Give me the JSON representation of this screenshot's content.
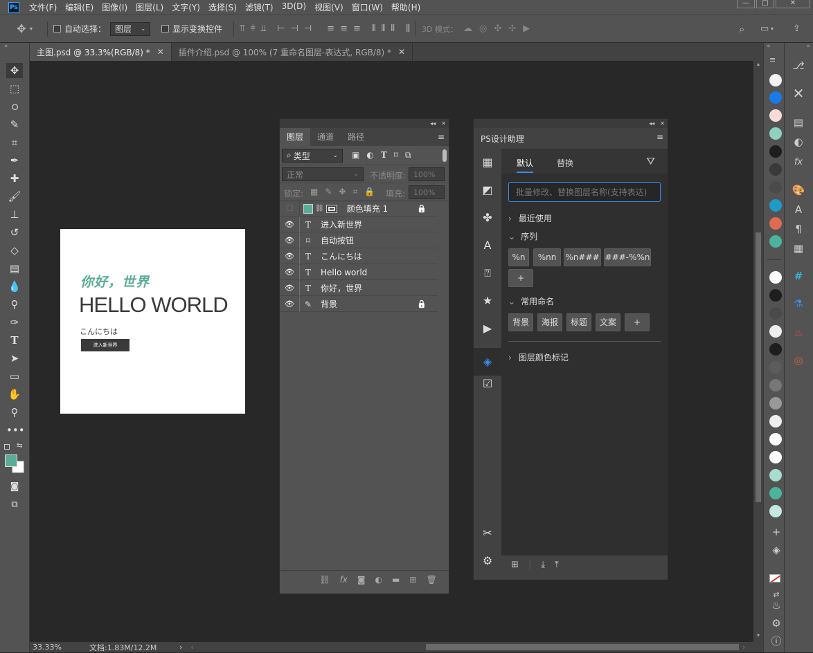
{
  "app": {
    "logo": "Ps"
  },
  "menu": [
    "文件(F)",
    "编辑(E)",
    "图像(I)",
    "图层(L)",
    "文字(Y)",
    "选择(S)",
    "滤镜(T)",
    "3D(D)",
    "视图(V)",
    "窗口(W)",
    "帮助(H)"
  ],
  "options": {
    "auto_select_label": "自动选择：",
    "auto_select_value": "图层",
    "show_transform_label": "显示变换控件",
    "mode_3d_label": "3D 模式："
  },
  "tabs": [
    {
      "label": "主图.psd @ 33.3%(RGB/8) *",
      "close": "✕",
      "active": true
    },
    {
      "label": "插件介绍.psd @ 100% (7 重命名图层-表达式, RGB/8) *",
      "close": "✕",
      "active": false
    }
  ],
  "document": {
    "chinese_title": "你好，世界",
    "headline": "HELLO WORLD",
    "japanese": "こんにちは",
    "button_text": "进入新世界",
    "accent": "#5aac98"
  },
  "status": {
    "zoom": "33.33%",
    "doc": "文档:1.83M/12.2M"
  },
  "layers_panel": {
    "tabs": [
      "图层",
      "通道",
      "路径"
    ],
    "filter": "类型",
    "blend_mode": "正常",
    "opacity_label": "不透明度:",
    "opacity_value": "100%",
    "lock_label": "锁定:",
    "fill_label": "填充:",
    "fill_value": "100%",
    "layers": [
      {
        "name": "颜色填充 1",
        "type": "fill",
        "visible": false,
        "locked": true
      },
      {
        "name": "进入新世界",
        "type": "text",
        "visible": true,
        "locked": false
      },
      {
        "name": "自动按钮",
        "type": "shape",
        "visible": true,
        "locked": false
      },
      {
        "name": "こんにちは",
        "type": "text",
        "visible": true,
        "locked": false
      },
      {
        "name": "Hello world",
        "type": "text",
        "visible": true,
        "locked": false
      },
      {
        "name": "你好，世界",
        "type": "text",
        "visible": true,
        "locked": false
      },
      {
        "name": "背景",
        "type": "brush",
        "visible": true,
        "locked": true
      }
    ]
  },
  "assistant_panel": {
    "title": "PS设计助理",
    "tabs": [
      "默认",
      "替换"
    ],
    "search_placeholder": "批量修改、替换图层名称(支持表达)",
    "sections": {
      "recent": "最近使用",
      "sequence": "序列",
      "common": "常用命名",
      "color_mark": "图层颜色标记"
    },
    "sequence_chips": [
      "%n",
      "%nn",
      "%n###",
      "###-%%n",
      "+"
    ],
    "name_chips": [
      "背景",
      "海报",
      "标题",
      "文案",
      "+"
    ]
  },
  "swatches": [
    "#f2f2f2",
    "#1a7ae8",
    "#f6dcd8",
    "#8fd0bf",
    "#1e1e1e",
    "#3a3a3a",
    "#4a4a4a",
    "#1f9ac9",
    "#e06b55",
    "#4db39a",
    "#ffffff",
    "#1e1e1e",
    "#4a4a4a",
    "#eeeeee",
    "#1e1e1e",
    "#5c5c5c",
    "#777777",
    "#999999",
    "#eeeeee",
    "#ffffff",
    "#ffffff",
    "#a8dccf",
    "#4db39a",
    "#c6e6e0",
    "#f2f2f2"
  ],
  "colors": {
    "foreground": "#5aac98",
    "background": "#ffffff"
  }
}
